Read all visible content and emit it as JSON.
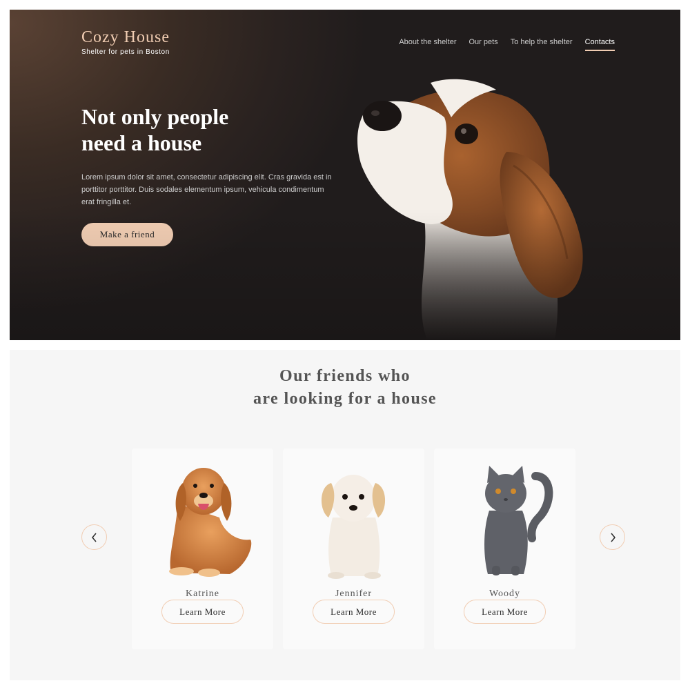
{
  "header": {
    "logo_title": "Cozy House",
    "logo_subtitle": "Shelter for pets in Boston",
    "nav": [
      {
        "label": "About the shelter"
      },
      {
        "label": "Our pets"
      },
      {
        "label": "To help the shelter"
      },
      {
        "label": "Contacts",
        "active": true
      }
    ]
  },
  "hero": {
    "title_line1": "Not only people",
    "title_line2": "need a house",
    "text": "Lorem ipsum dolor sit amet, consectetur adipiscing elit. Cras gravida est in porttitor porttitor. Duis sodales elementum ipsum, vehicula condimentum erat fringilla et.",
    "button_label": "Make a friend",
    "image_icon": "beagle-puppy-photo"
  },
  "pets": {
    "title_line1": "Our friends who",
    "title_line2": "are looking for a house",
    "prev_icon": "chevron-left-icon",
    "next_icon": "chevron-right-icon",
    "cards": [
      {
        "name": "Katrine",
        "button_label": "Learn More",
        "image_icon": "golden-retriever-photo"
      },
      {
        "name": "Jennifer",
        "button_label": "Learn More",
        "image_icon": "puppy-photo"
      },
      {
        "name": "Woody",
        "button_label": "Learn More",
        "image_icon": "grey-cat-photo"
      }
    ]
  },
  "colors": {
    "accent": "#f1cdb3",
    "hero_bg": "#2a2220",
    "pets_bg": "#f6f6f6",
    "card_bg": "#fafafa",
    "title_text": "#545454"
  }
}
